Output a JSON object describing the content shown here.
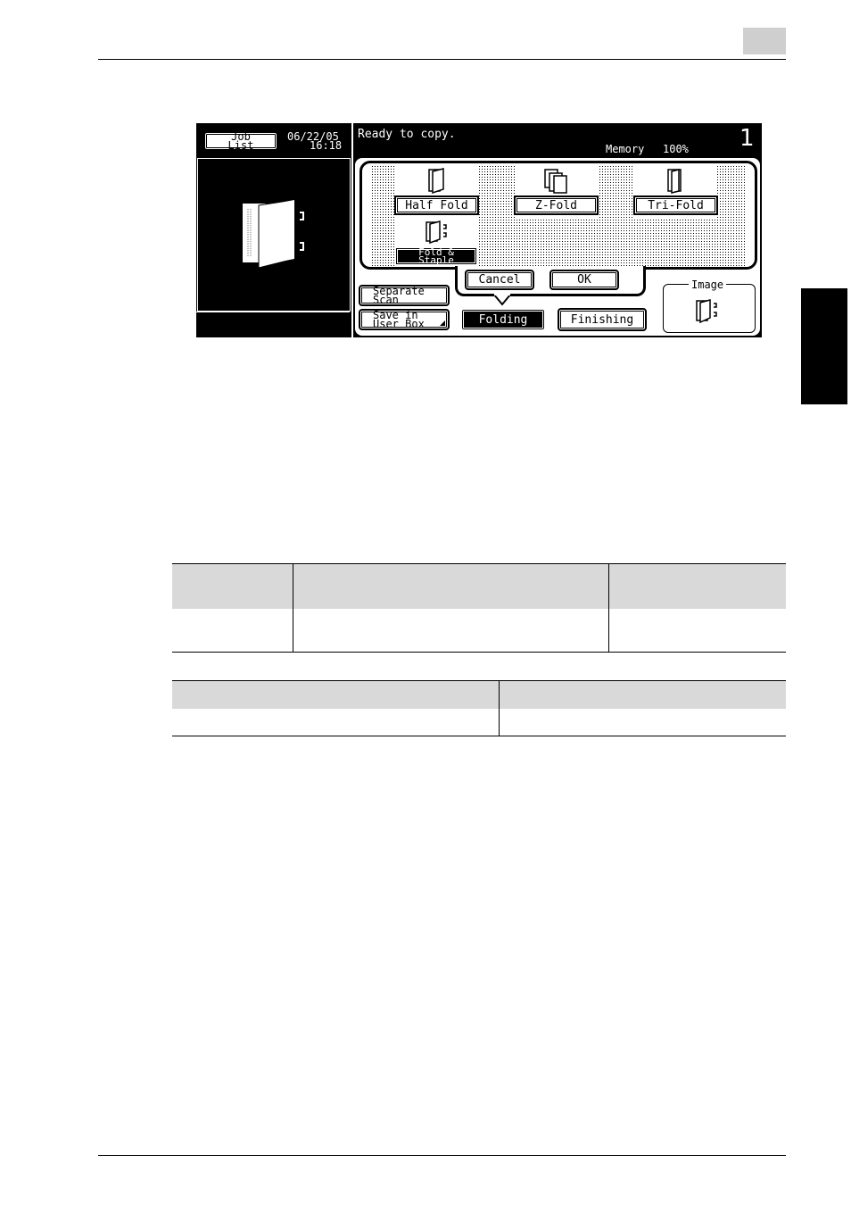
{
  "screen": {
    "job_list_label_line1": "Job",
    "job_list_label_line2": "List",
    "date": "06/22/05",
    "time": "16:18",
    "status_message": "Ready to copy.",
    "memory_label": "Memory",
    "memory_value": "100%",
    "copy_count": "1",
    "options": [
      {
        "label": "Half Fold",
        "icon": "half-fold-icon"
      },
      {
        "label": "Z-Fold",
        "icon": "z-fold-icon"
      },
      {
        "label": "Tri-Fold",
        "icon": "tri-fold-icon"
      },
      {
        "label_line1": "Fold &",
        "label_line2": "Staple",
        "icon": "fold-staple-icon",
        "selected": true
      }
    ],
    "cancel_label": "Cancel",
    "ok_label": "OK",
    "separate_scan_line1": "Separate",
    "separate_scan_line2": "Scan",
    "save_box_line1": "Save in",
    "save_box_line2": "User Box",
    "tab_folding": "Folding",
    "tab_finishing": "Finishing",
    "image_label": "Image"
  },
  "tables": {
    "table1": {
      "columns": 3,
      "rows": 2
    },
    "table2": {
      "columns": 2,
      "rows": 2
    }
  }
}
